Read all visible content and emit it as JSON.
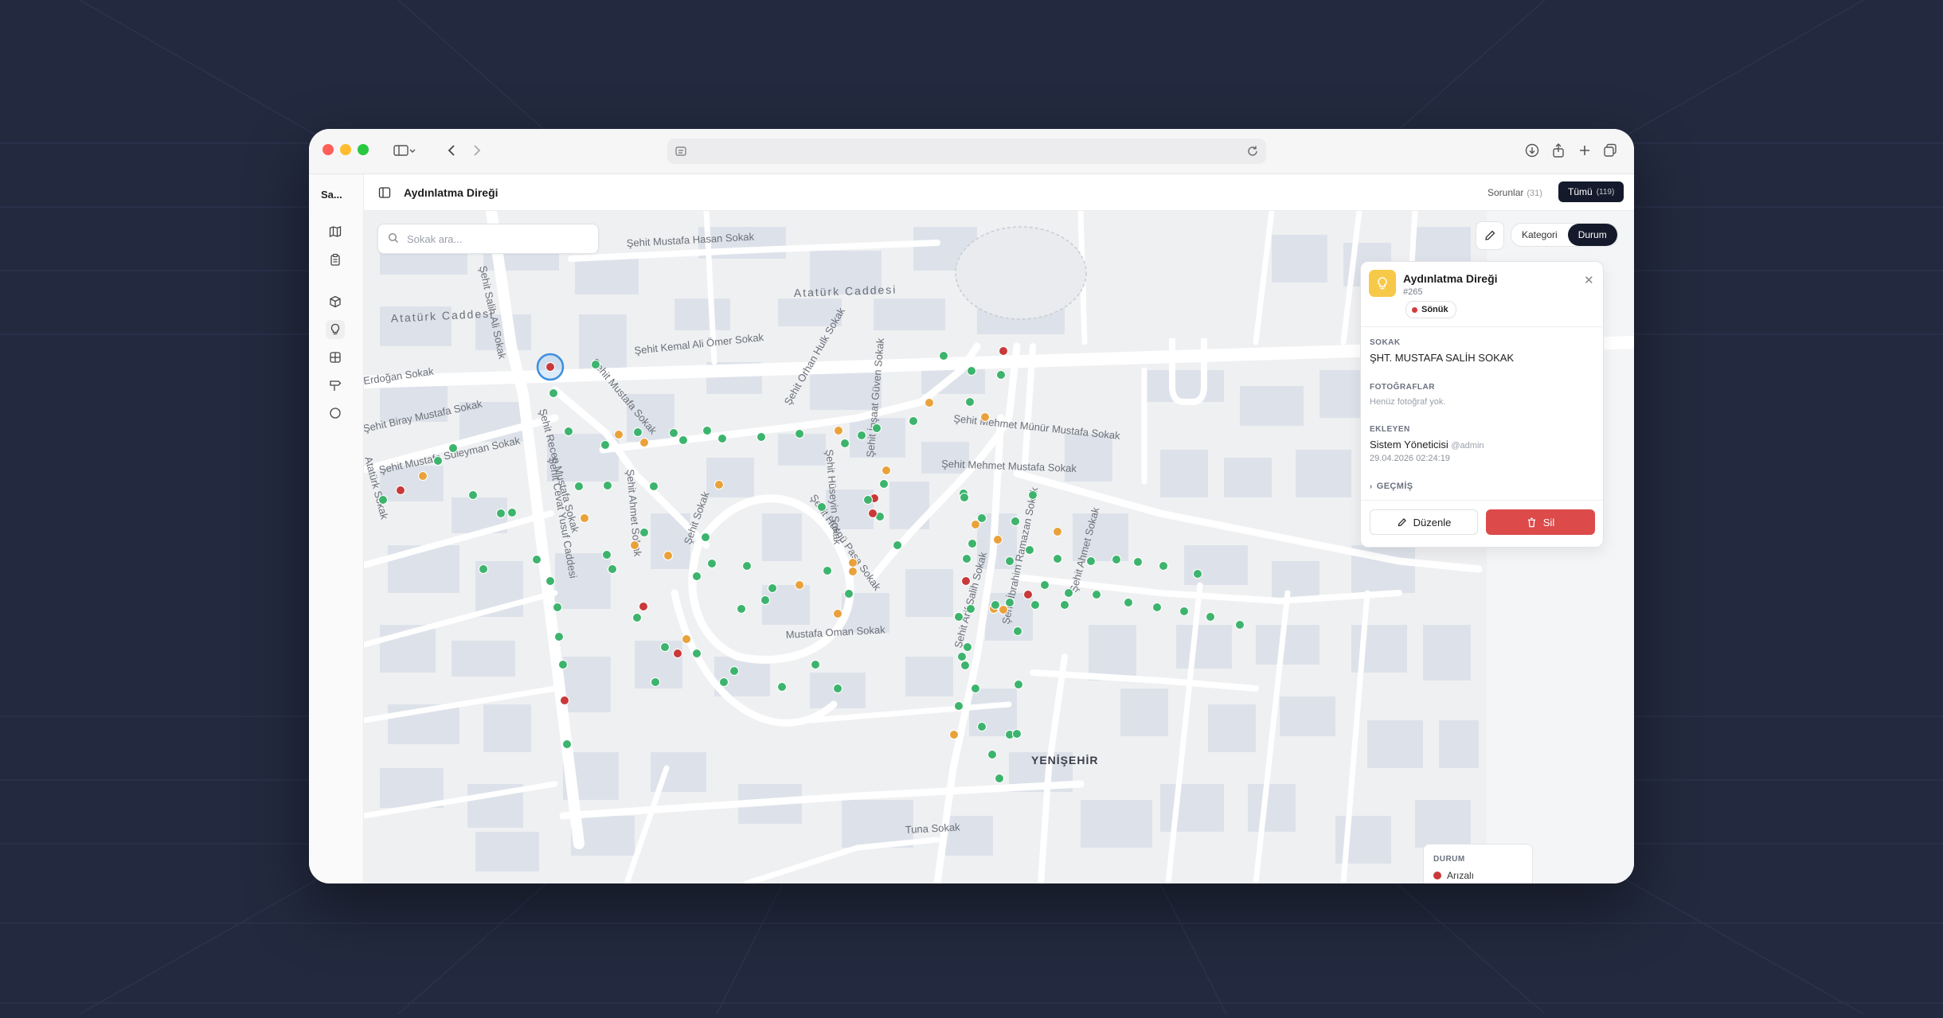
{
  "app": {
    "brand": "Sa...",
    "page_title": "Aydınlatma Direği"
  },
  "header": {
    "issues_label": "Sorunlar",
    "issues_count": "(31)",
    "all_label": "Tümü",
    "all_count": "(119)"
  },
  "search": {
    "placeholder": "Sokak ara..."
  },
  "filter": {
    "options": [
      "Kategori",
      "Durum"
    ],
    "selected": "Durum"
  },
  "detail": {
    "title": "Aydınlatma Direği",
    "id": "#265",
    "status": "Sönük",
    "street_label": "SOKAK",
    "street_value": "ŞHT. MUSTAFA SALİH SOKAK",
    "photos_label": "FOTOĞRAFLAR",
    "photos_empty": "Henüz fotoğraf yok.",
    "added_by_label": "EKLEYEN",
    "added_by_name": "Sistem Yöneticisi",
    "added_by_handle": "@admin",
    "added_at": "29.04.2026 02:24:19",
    "history_label": "GEÇMİŞ",
    "edit_label": "Düzenle",
    "delete_label": "Sil"
  },
  "legend": {
    "title": "DURUM",
    "items": [
      {
        "label": "Arızalı",
        "color": "#c9393a"
      }
    ]
  },
  "map": {
    "district": "YENİŞEHİR",
    "streets": [
      "Şehit Mustafa Hasan Sokak",
      "Şehit Salih Ali Sokak",
      "Atatürk Caddesi",
      "Atatürk Caddesi",
      "Erdoğan Sokak",
      "Şehit Kemal Ali Ömer Sokak",
      "Şehit Mustafa Sokak",
      "Şehit Biray Mustafa Sokak",
      "Şehit Recep Mustafa Sokak",
      "Şehit Mustafa Süleyman Sokak",
      "Şehit Cevat Yusuf Caddesi",
      "Şehit Ahmet Sokak",
      "Şehit Orhan Hulk Sokak",
      "Şehit Mehmet Münür Mustafa Sokak",
      "Şehit Mehmet Mustafa Sokak",
      "Şehit İnşaat Güven Sokak",
      "Şehit Hüseyin Sokak",
      "Şehit Hüsnü Paşa Sokak",
      "Şehit Sokak",
      "Mustafa Oman Sokak",
      "Şehit Arif Salih Sokak",
      "Şehit İbrahim Ramazan Sokak",
      "Şehit Ahmet Sokak",
      "Tuna Sokak",
      "Atatürk Sokak"
    ],
    "status_colors": {
      "ok": "#3db46d",
      "warning": "#e9a23b",
      "broken": "#c9393a",
      "selected_ring": "#3b8fe0"
    }
  }
}
